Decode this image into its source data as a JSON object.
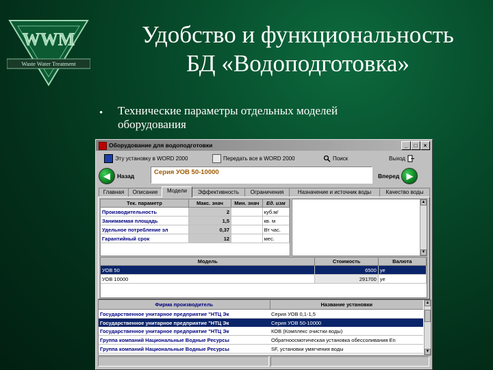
{
  "slide": {
    "logo_text": "WWM",
    "logo_caption": "Waste Water Treatment",
    "title_line1": "Удобство и функциональность",
    "title_line2": "БД «Водоподготовка»",
    "bullet_line1": "Технические параметры отдельных моделей",
    "bullet_line2": "оборудования"
  },
  "window": {
    "title": "Оборудование для водоподготовки",
    "controls": [
      "_",
      "□",
      "×"
    ],
    "toolbar": {
      "word_label": "Эту установку в WORD 2000",
      "send_all_label": "Передать все в WORD 2000",
      "search_label": "Поиск",
      "exit_label": "Выход"
    },
    "nav": {
      "back_label": "Назад",
      "forward_label": "Вперед",
      "series_text": "Серия УОВ 50-10000"
    },
    "tabs": [
      "Главная",
      "Описание",
      "Модели",
      "Эффективность",
      "Ограничения",
      "Назначение и источник воды",
      "Качество воды"
    ],
    "active_tab": "Модели",
    "params_grid": {
      "headers": [
        "Тек. параметр",
        "Макс. знач",
        "Мин. знач",
        "Ед. изм"
      ],
      "rows": [
        {
          "name": "Производительность",
          "max": "2",
          "min": "",
          "unit": "куб.м/"
        },
        {
          "name": "Занимаемая площадь",
          "max": "1,5",
          "min": "",
          "unit": "кв. м"
        },
        {
          "name": "Удельное потребление эл",
          "max": "0,37",
          "min": "",
          "unit": "Вт час."
        },
        {
          "name": "Гарантийный срок",
          "max": "12",
          "min": "",
          "unit": "мес."
        }
      ]
    },
    "models_grid": {
      "headers": [
        "Модель",
        "Стоимость",
        "Валюта"
      ],
      "rows": [
        {
          "model": "УОВ 50",
          "cost": "6500",
          "currency": "ye"
        },
        {
          "model": "УОВ 10000",
          "cost": "291700",
          "currency": "ye"
        }
      ]
    },
    "vendors_grid": {
      "headers": [
        "Фирма производитель",
        "Название установки"
      ],
      "rows": [
        {
          "firm": "Государственное унитарное предприятие \"НТЦ Эк",
          "unit": "Серия УОВ 0,1-1,5"
        },
        {
          "firm": "Государственное унитарное предприятие \"НТЦ Эк",
          "unit": "Серия УОВ 50-10000"
        },
        {
          "firm": "Государственное унитарное предприятие \"НТЦ Эк",
          "unit": "КОВ (Комплекс очистки воды)"
        },
        {
          "firm": "Группа компаний Национальные Водные Ресурсы",
          "unit": "Обратноосмотическая установка обессоливания En"
        },
        {
          "firm": "Группа компаний Национальные Водные Ресурсы",
          "unit": "SF, установки умягчения воды"
        }
      ]
    }
  },
  "colors": {
    "background": "#064a2a",
    "selection": "#0a246a",
    "param_name": "#00007f",
    "series_text": "#a05a00"
  }
}
